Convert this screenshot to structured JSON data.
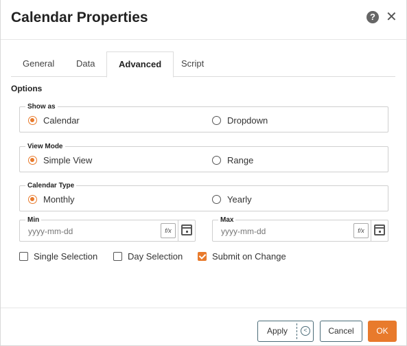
{
  "dialog": {
    "title": "Calendar Properties",
    "help_icon": "help-icon",
    "close_icon": "close-icon"
  },
  "tabs": [
    {
      "label": "General",
      "active": false
    },
    {
      "label": "Data",
      "active": false
    },
    {
      "label": "Advanced",
      "active": true
    },
    {
      "label": "Script",
      "active": false
    }
  ],
  "options": {
    "title": "Options",
    "show_as": {
      "legend": "Show as",
      "choices": [
        "Calendar",
        "Dropdown"
      ],
      "selected": "Calendar"
    },
    "view_mode": {
      "legend": "View Mode",
      "choices": [
        "Simple View",
        "Range"
      ],
      "selected": "Simple View"
    },
    "calendar_type": {
      "legend": "Calendar Type",
      "choices": [
        "Monthly",
        "Yearly"
      ],
      "selected": "Monthly"
    },
    "min": {
      "legend": "Min",
      "value": "",
      "placeholder": "yyyy-mm-dd"
    },
    "max": {
      "legend": "Max",
      "value": "",
      "placeholder": "yyyy-mm-dd"
    },
    "checkboxes": [
      {
        "label": "Single Selection",
        "checked": false
      },
      {
        "label": "Day Selection",
        "checked": false
      },
      {
        "label": "Submit on Change",
        "checked": true
      }
    ]
  },
  "footer": {
    "apply_label": "Apply",
    "cancel_label": "Cancel",
    "ok_label": "OK"
  },
  "colors": {
    "accent": "#e87a2c",
    "button_border": "#4a6b78"
  }
}
